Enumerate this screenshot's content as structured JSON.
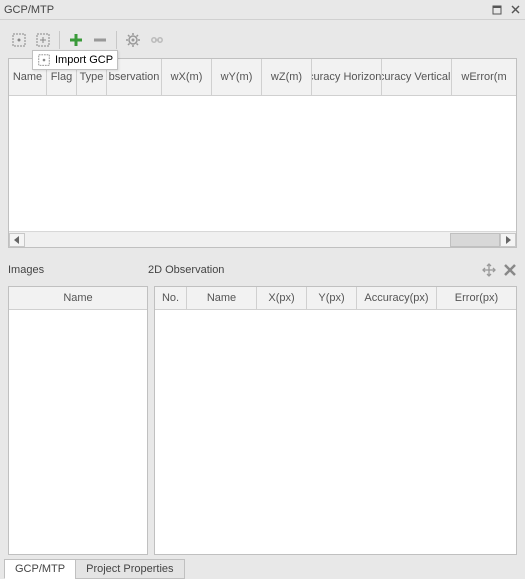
{
  "titlebar": {
    "title": "GCP/MTP"
  },
  "tooltip": {
    "label": "Import GCP"
  },
  "upper_table": {
    "columns": [
      "Name",
      "Flag",
      "Type",
      "bservation",
      "wX(m)",
      "wY(m)",
      "wZ(m)",
      "Accuracy Horizon(m)",
      "Accuracy Vertical(m)",
      "wError(m"
    ]
  },
  "images_panel": {
    "title": "Images",
    "columns": [
      "Name"
    ]
  },
  "observation_panel": {
    "title": "2D Observation",
    "columns": [
      "No.",
      "Name",
      "X(px)",
      "Y(px)",
      "Accuracy(px)",
      "Error(px)"
    ]
  },
  "tabs": {
    "items": [
      "GCP/MTP",
      "Project Properties"
    ],
    "active": 0
  }
}
